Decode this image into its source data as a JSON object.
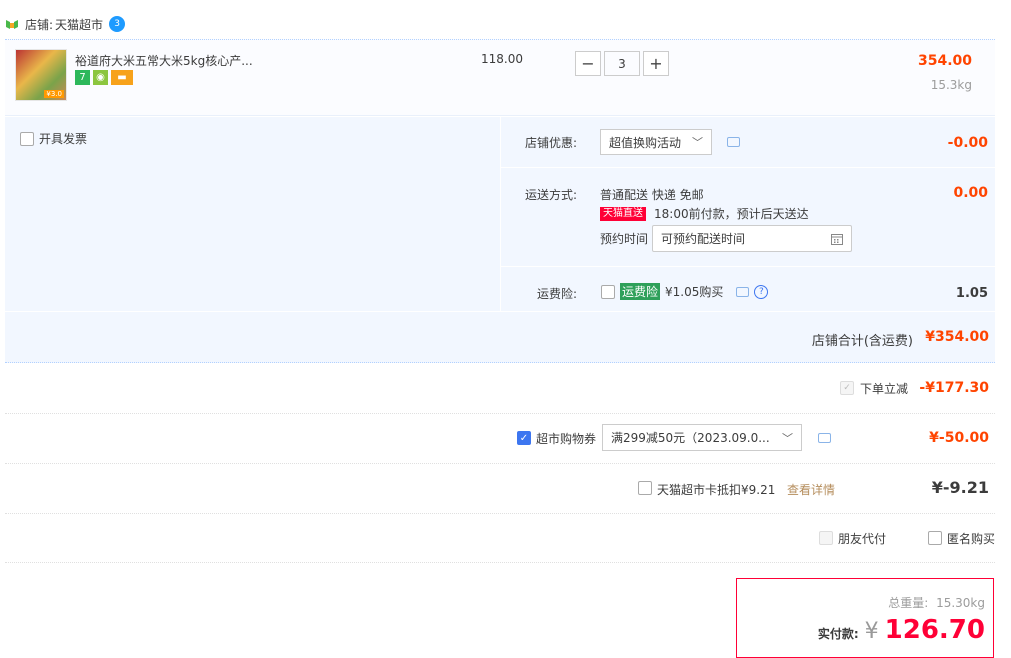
{
  "shop": {
    "label": "店铺:",
    "name": "天猫超市",
    "ww_badge": "3"
  },
  "item": {
    "title": "裕道府大米五常大米5kg核心产...",
    "thumb_label": "¥3.0",
    "tags": [
      {
        "glyph": "7",
        "color": "#2db85b"
      },
      {
        "glyph": "◉",
        "color": "#8cc63f"
      },
      {
        "glyph": "▬",
        "color": "#f7a21b"
      }
    ],
    "price": "118.00",
    "qty": "3",
    "minus": "−",
    "plus": "+",
    "subtotal": "354.00",
    "weight": "15.3kg"
  },
  "options": {
    "invoice_label": "开具发票",
    "discount_label": "店铺优惠:",
    "discount_select": "超值换购活动",
    "discount_value": "-0.00",
    "shipping_label": "运送方式:",
    "shipping_method": "普通配送 快递 免邮",
    "shipping_value": "0.00",
    "tmall_badge": "天猫直送",
    "delivery_note": "18:00前付款，预计后天送达",
    "appointment_label": "预约时间",
    "appointment_placeholder": "可预约配送时间",
    "insurance_label": "运费险:",
    "insurance_badge": "运费险",
    "insurance_price": "¥1.05购买",
    "insurance_value": "1.05"
  },
  "shop_total": {
    "label": "店铺合计(含运费)",
    "value": "¥354.00"
  },
  "order_discount": {
    "label": "下单立减",
    "value": "-¥177.30"
  },
  "coupon": {
    "label": "超市购物券",
    "select": "满299减50元（2023.09.0...",
    "value": "¥-50.00"
  },
  "card": {
    "label": "天猫超市卡抵扣¥9.21",
    "link": "查看详情",
    "value": "¥-9.21"
  },
  "extras": {
    "friend_pay": "朋友代付",
    "anonymous": "匿名购买"
  },
  "final": {
    "weight_label": "总重量:",
    "weight": "15.30kg",
    "paid_label": "实付款:",
    "currency": "¥",
    "amount": "126.70"
  },
  "colors": {
    "price_red": "#ff4400",
    "accent_blue": "#3d76f0",
    "panel_bg": "#f2f7ff"
  }
}
